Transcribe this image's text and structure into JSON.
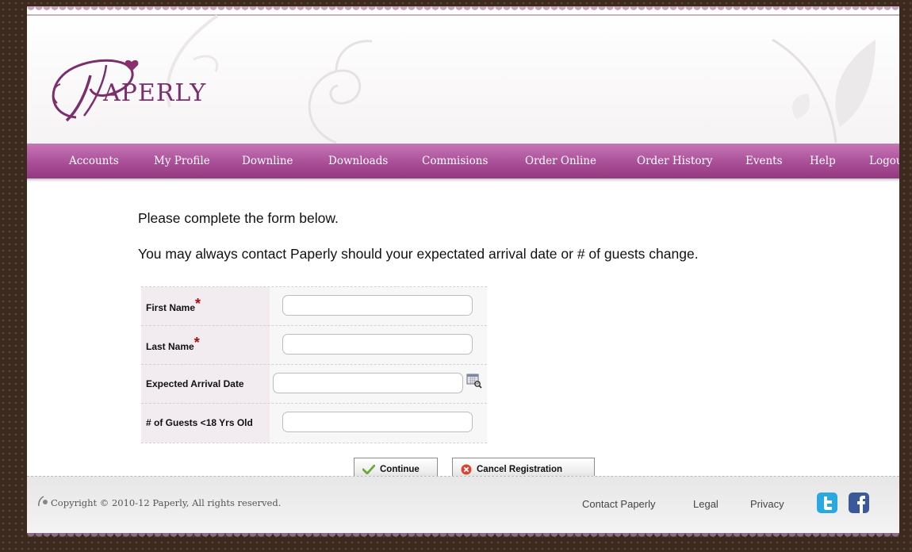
{
  "brand": {
    "logo_text": "APERLY",
    "logo_initial": "P"
  },
  "nav": {
    "items": [
      {
        "label": "Accounts"
      },
      {
        "label": "My Profile"
      },
      {
        "label": "Downline"
      },
      {
        "label": "Downloads"
      },
      {
        "label": "Commisions"
      },
      {
        "label": "Order Online"
      },
      {
        "label": "Order History"
      },
      {
        "label": "Events"
      },
      {
        "label": "Help"
      },
      {
        "label": "Logout"
      }
    ]
  },
  "main": {
    "intro_1": "Please complete the form below.",
    "intro_2": "You may always contact Paperly should your expectated arrival date or # of guests change.",
    "form": {
      "first_name_label": "First Name",
      "last_name_label": "Last Name",
      "arrival_date_label": "Expected Arrival Date",
      "guests_label": "# of Guests <18 Yrs Old",
      "required_marker": "*",
      "first_name_value": "",
      "last_name_value": "",
      "arrival_date_value": "",
      "guests_value": ""
    },
    "buttons": {
      "continue_label": "Continue",
      "cancel_label": "Cancel Registration"
    }
  },
  "footer": {
    "copyright": "Copyright © 2010-12 Paperly, All rights reserved.",
    "links": {
      "contact": "Contact Paperly",
      "legal": "Legal",
      "privacy": "Privacy"
    },
    "social_icons": [
      "twitter-icon",
      "facebook-icon"
    ]
  },
  "colors": {
    "nav_purple": "#a94f98",
    "brand_purple": "#7a2f6c",
    "border_brown": "#3d2a1e",
    "required_red": "#a01010",
    "twitter_blue": "#2aa9e0",
    "facebook_blue": "#3b5998"
  }
}
